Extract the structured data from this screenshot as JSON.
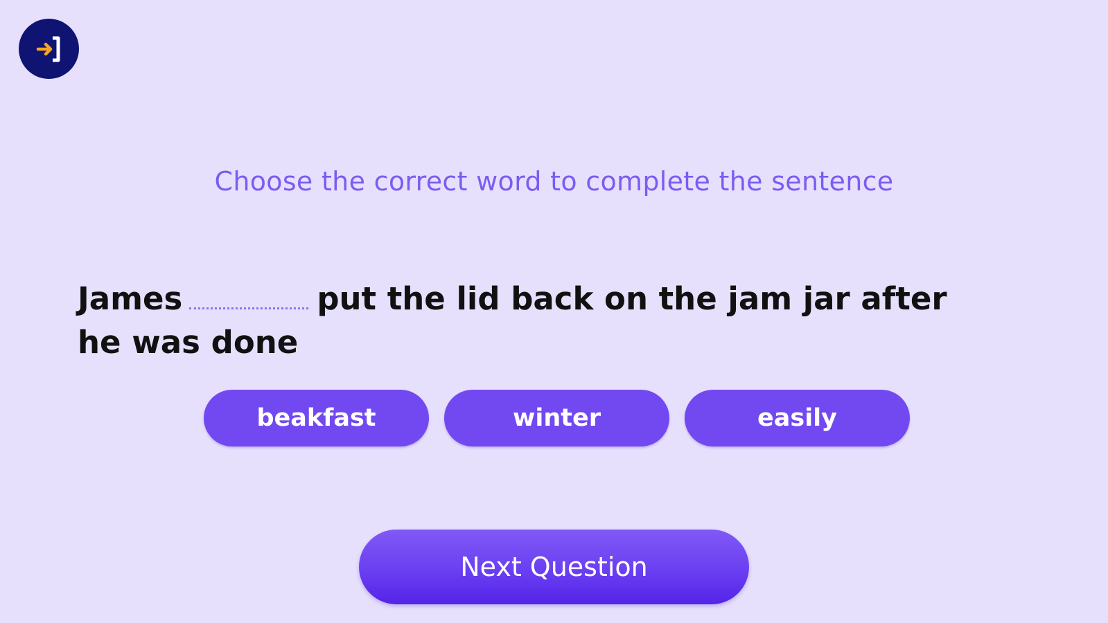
{
  "header": {
    "exit_icon": "exit-door-arrow-icon"
  },
  "quiz": {
    "instruction": "Choose the correct word to complete the sentence",
    "sentence_before": "James",
    "sentence_after": "put the lid back on the jam jar after he was done",
    "options": [
      {
        "label": "beakfast"
      },
      {
        "label": "winter"
      },
      {
        "label": "easily"
      }
    ],
    "next_label": "Next Question"
  },
  "colors": {
    "background": "#e6e0fd",
    "accent": "#7249f0",
    "instruction_text": "#7b5cf2",
    "exit_button": "#0f1472",
    "exit_arrow": "#f5a623"
  }
}
